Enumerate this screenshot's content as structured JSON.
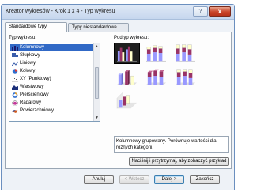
{
  "window": {
    "title": "Kreator wykresów - Krok 1 z 4 - Typ wykresu",
    "help_glyph": "?",
    "close_glyph": "x"
  },
  "tabs": [
    {
      "label": "Standardowe typy",
      "active": true
    },
    {
      "label": "Typy niestandardowe",
      "active": false
    }
  ],
  "chart_type_label": "Typ wykresu:",
  "chart_subtype_label": "Podtyp wykresu:",
  "chart_types": [
    {
      "label": "Kolumnowy",
      "icon": "column-chart-icon",
      "selected": true
    },
    {
      "label": "Słupkowy",
      "icon": "bar-chart-icon",
      "selected": false
    },
    {
      "label": "Liniowy",
      "icon": "line-chart-icon",
      "selected": false
    },
    {
      "label": "Kołowy",
      "icon": "pie-chart-icon",
      "selected": false
    },
    {
      "label": "XY (Punktowy)",
      "icon": "scatter-chart-icon",
      "selected": false
    },
    {
      "label": "Warstwowy",
      "icon": "area-chart-icon",
      "selected": false
    },
    {
      "label": "Pierścieniowy",
      "icon": "doughnut-chart-icon",
      "selected": false
    },
    {
      "label": "Radarowy",
      "icon": "radar-chart-icon",
      "selected": false
    },
    {
      "label": "Powierzchniowy",
      "icon": "surface-chart-icon",
      "selected": false
    }
  ],
  "description": "Kolumnowy grupowany. Porównuje wartości dla różnych kategorii.",
  "preview_button": "Naciśnij i przytrzymaj, aby zobaczyć przykład",
  "buttons": {
    "cancel": "Anuluj",
    "back": "< Wstecz",
    "next": "Dalej >",
    "finish": "Zakończ"
  },
  "colors": {
    "selection": "#3169c6",
    "series_1": "#9999ff",
    "series_2": "#993366",
    "series_3": "#ffffcc"
  }
}
